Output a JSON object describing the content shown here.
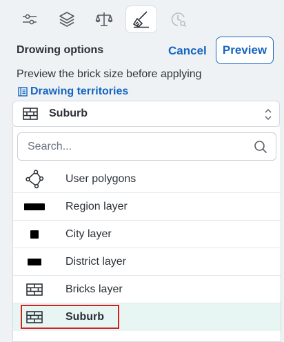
{
  "toolbar": {
    "tabs": [
      {
        "icon": "sliders-icon",
        "active": false
      },
      {
        "icon": "layers-icon",
        "active": false
      },
      {
        "icon": "scale-icon",
        "active": false
      },
      {
        "icon": "brush-icon",
        "active": true
      },
      {
        "icon": "history-clock-icon",
        "active": false
      }
    ]
  },
  "header": {
    "title": "Drowing options",
    "cancel_label": "Cancel",
    "preview_label": "Preview"
  },
  "description": "Preview the brick size before applying",
  "territories_link": "Drawing territories",
  "select": {
    "value": "Suburb",
    "icon": "bricks-icon"
  },
  "dropdown": {
    "search_placeholder": "Search...",
    "items": [
      {
        "label": "User polygons",
        "icon": "polygon-icon"
      },
      {
        "label": "Region layer",
        "icon": "region-icon"
      },
      {
        "label": "City layer",
        "icon": "city-icon"
      },
      {
        "label": "District layer",
        "icon": "district-icon"
      },
      {
        "label": "Bricks layer",
        "icon": "bricks-icon"
      },
      {
        "label": "Suburb",
        "icon": "bricks-icon",
        "selected": true
      }
    ]
  },
  "colors": {
    "accent": "#1565c0",
    "selected_row": "#e8f6f3",
    "highlight": "#d32020",
    "background": "#eef2f5"
  }
}
